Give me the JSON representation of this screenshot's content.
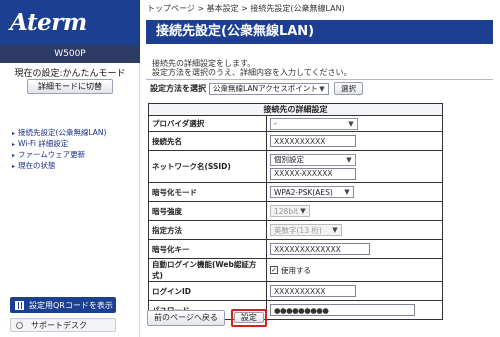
{
  "sidebar": {
    "logo": "Aterm",
    "model": "W500P",
    "mode_text": "現在の設定:かんたんモード",
    "mode_button": "詳細モードに切替",
    "nav": [
      "接続先設定(公衆無線LAN)",
      "Wi-Fi 詳細設定",
      "ファームウェア更新",
      "現在の状態"
    ],
    "qr_button": "設定用QRコードを表示",
    "support_button": "サポートデスク"
  },
  "breadcrumb": "トップページ > 基本設定 > 接続先設定(公衆無線LAN)",
  "page_title": "接続先設定(公衆無線LAN)",
  "intro": [
    "接続先の詳細設定をします。",
    "設定方法を選択のうえ、詳細内容を入力してください。"
  ],
  "method": {
    "label": "設定方法を選択",
    "value": "公衆無線LANアクセスポイント",
    "select_button": "選択"
  },
  "table": {
    "header": "接続先の詳細設定",
    "rows": {
      "provider": {
        "label": "プロバイダ選択",
        "value": "-"
      },
      "conn_name": {
        "label": "接続先名",
        "value": "XXXXXXXXXX"
      },
      "ssid": {
        "label": "ネットワーク名(SSID)",
        "select": "個別設定",
        "value": "XXXXX-XXXXXX"
      },
      "encryption": {
        "label": "暗号化モード",
        "value": "WPA2-PSK(AES)"
      },
      "strength": {
        "label": "暗号強度",
        "value": "128bit"
      },
      "method": {
        "label": "指定方法",
        "value": "英数字(13 桁)"
      },
      "key": {
        "label": "暗号化キー",
        "value": "XXXXXXXXXXXXX"
      },
      "auto_login": {
        "label": "自動ログイン機能(Web認証方式)",
        "value": "使用する"
      },
      "login_id": {
        "label": "ログインID",
        "value": "XXXXXXXXXX"
      },
      "password": {
        "label": "パスワード",
        "value": "●●●●●●●●●"
      }
    }
  },
  "footer": {
    "back_button": "前のページへ戻る",
    "set_button": "設定"
  }
}
